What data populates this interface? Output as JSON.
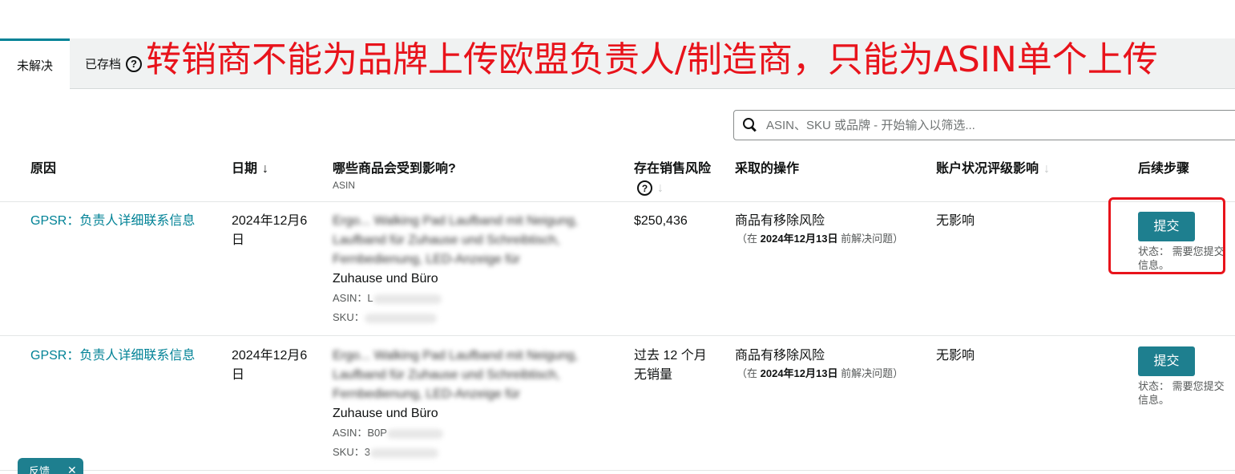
{
  "tabs": {
    "unresolved": "未解决",
    "archived": "已存档",
    "help_glyph": "?"
  },
  "annotation": {
    "text": "转销商不能为品牌上传欧盟负责人/制造商，只能为ASIN单个上传",
    "color": "#e8131b"
  },
  "search": {
    "placeholder": "ASIN、SKU 或品牌 - 开始输入以筛选..."
  },
  "table": {
    "headers": {
      "reason": "原因",
      "date": "日期",
      "date_sort": "↓",
      "affected": "哪些商品会受到影响?",
      "affected_sub": "ASIN",
      "risk": "存在销售风险",
      "risk_help": "?",
      "risk_sort": "↓",
      "action": "采取的操作",
      "health": "账户状况评级影响",
      "health_sort": "↓",
      "next": "后续步骤"
    },
    "rows": [
      {
        "reason": "GPSR：负责人详细联系信息",
        "date": "2024年12月6日",
        "product": "Ergo... Walking Pad Laufband mit Neigung, Laufband für Zuhause und Schreibtisch, Fernbedienung, LED-Anzeige für",
        "product_tail": "Zuhause und Büro",
        "asin_label": "ASIN：",
        "asin_value": "L",
        "sku_label": "SKU：",
        "sku_value": "",
        "risk": "$250,436",
        "action": "商品有移除风险",
        "action_note_pre": "（在 ",
        "action_note_date": "2024年12月13日",
        "action_note_post": " 前解决问题）",
        "health": "无影响",
        "button": "提交",
        "status": "状态： 需要您提交信息。"
      },
      {
        "reason": "GPSR：负责人详细联系信息",
        "date": "2024年12月6日",
        "product": "Ergo... Walking Pad Laufband mit Neigung, Laufband für Zuhause und Schreibtisch, Fernbedienung, LED-Anzeige für",
        "product_tail": "Zuhause und Büro",
        "asin_label": "ASIN：",
        "asin_value": "B0P",
        "sku_label": "SKU：",
        "sku_value": "3",
        "risk": "过去 12 个月无销量",
        "action": "商品有移除风险",
        "action_note_pre": "（在 ",
        "action_note_date": "2024年12月13日",
        "action_note_post": " 前解决问题）",
        "health": "无影响",
        "button": "提交",
        "status": "状态： 需要您提交信息。"
      }
    ]
  },
  "feedback": {
    "label": "反馈",
    "close": "✕"
  },
  "colors": {
    "teal": "#008296",
    "button": "#1e7f8f",
    "annotation_red": "#e8131b"
  }
}
